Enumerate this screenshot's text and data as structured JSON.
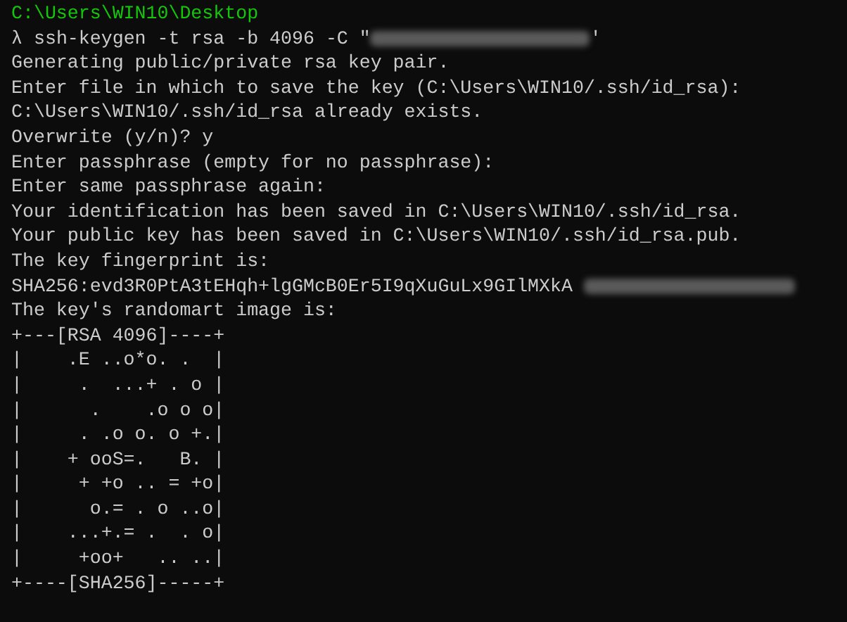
{
  "terminal": {
    "lines": [
      {
        "kind": "path",
        "text": "C:\\Users\\WIN10\\Desktop"
      },
      {
        "kind": "command",
        "prompt": "λ",
        "text": "ssh-keygen -t rsa -b 4096 -C \"",
        "redacted": true,
        "suffix": "'"
      },
      {
        "kind": "output",
        "text": "Generating public/private rsa key pair."
      },
      {
        "kind": "output",
        "text": "Enter file in which to save the key (C:\\Users\\WIN10/.ssh/id_rsa):"
      },
      {
        "kind": "output",
        "text": "C:\\Users\\WIN10/.ssh/id_rsa already exists."
      },
      {
        "kind": "output",
        "text": "Overwrite (y/n)? y"
      },
      {
        "kind": "output",
        "text": "Enter passphrase (empty for no passphrase):"
      },
      {
        "kind": "output",
        "text": "Enter same passphrase again:"
      },
      {
        "kind": "output",
        "text": "Your identification has been saved in C:\\Users\\WIN10/.ssh/id_rsa."
      },
      {
        "kind": "output",
        "text": "Your public key has been saved in C:\\Users\\WIN10/.ssh/id_rsa.pub."
      },
      {
        "kind": "output",
        "text": "The key fingerprint is:"
      },
      {
        "kind": "output",
        "text": "SHA256:evd3R0PtA3tEHqh+lgGMcB0Er5I9qXuGuLx9GIlMXkA",
        "redacted": true
      },
      {
        "kind": "output",
        "text": "The key's randomart image is:"
      },
      {
        "kind": "output",
        "text": "+---[RSA 4096]----+"
      },
      {
        "kind": "output",
        "text": "|    .E ..o*o. .  |"
      },
      {
        "kind": "output",
        "text": "|     .  ...+ . o |"
      },
      {
        "kind": "output",
        "text": "|      .    .o o o|"
      },
      {
        "kind": "output",
        "text": "|     . .o o. o +.|"
      },
      {
        "kind": "output",
        "text": "|    + ooS=.   B. |"
      },
      {
        "kind": "output",
        "text": "|     + +o .. = +o|"
      },
      {
        "kind": "output",
        "text": "|      o.= . o ..o|"
      },
      {
        "kind": "output",
        "text": "|    ...+.= .  . o|"
      },
      {
        "kind": "output",
        "text": "|     +oo+   .. ..|"
      },
      {
        "kind": "output",
        "text": "+----[SHA256]-----+"
      }
    ]
  }
}
